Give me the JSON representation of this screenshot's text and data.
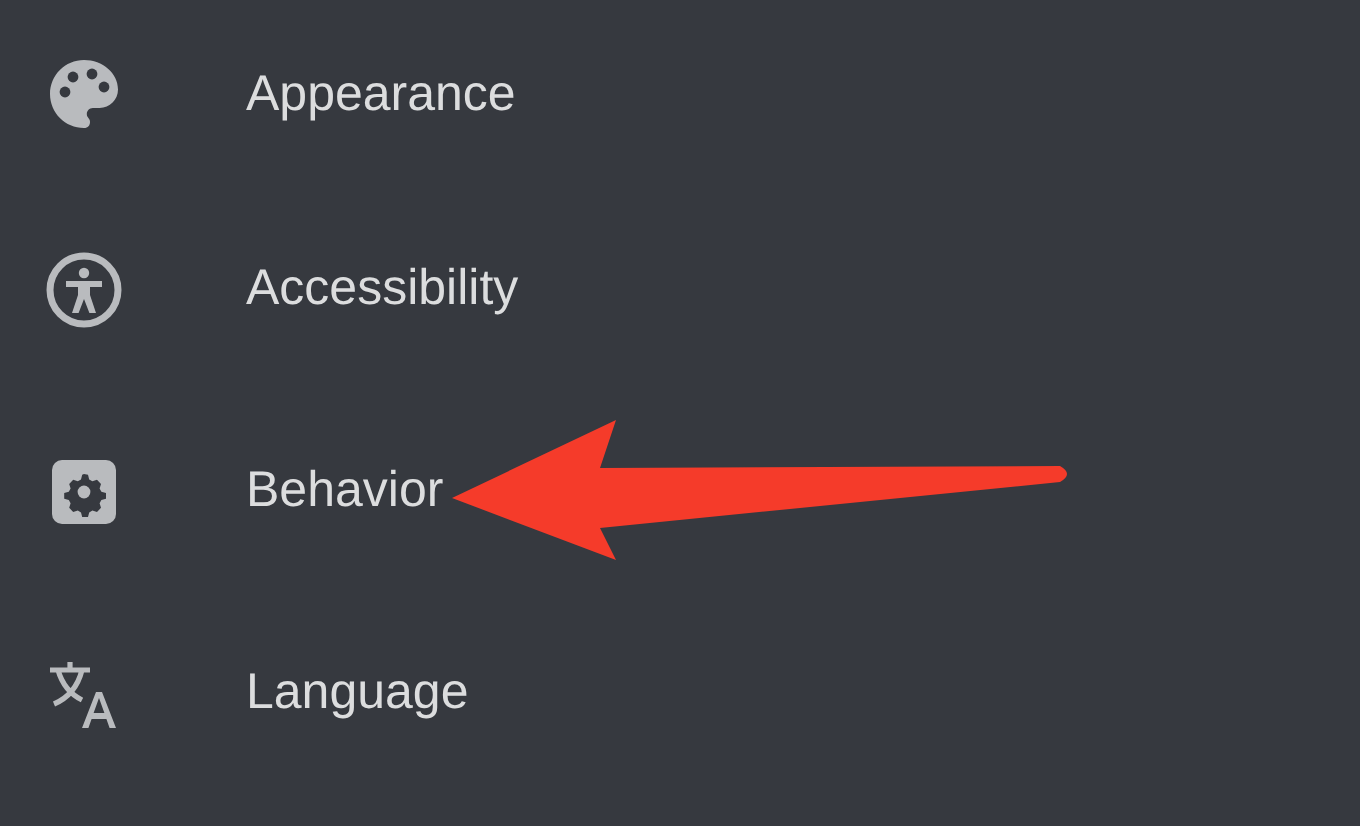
{
  "settings_items": [
    {
      "label": "Appearance"
    },
    {
      "label": "Accessibility"
    },
    {
      "label": "Behavior"
    },
    {
      "label": "Language"
    }
  ]
}
